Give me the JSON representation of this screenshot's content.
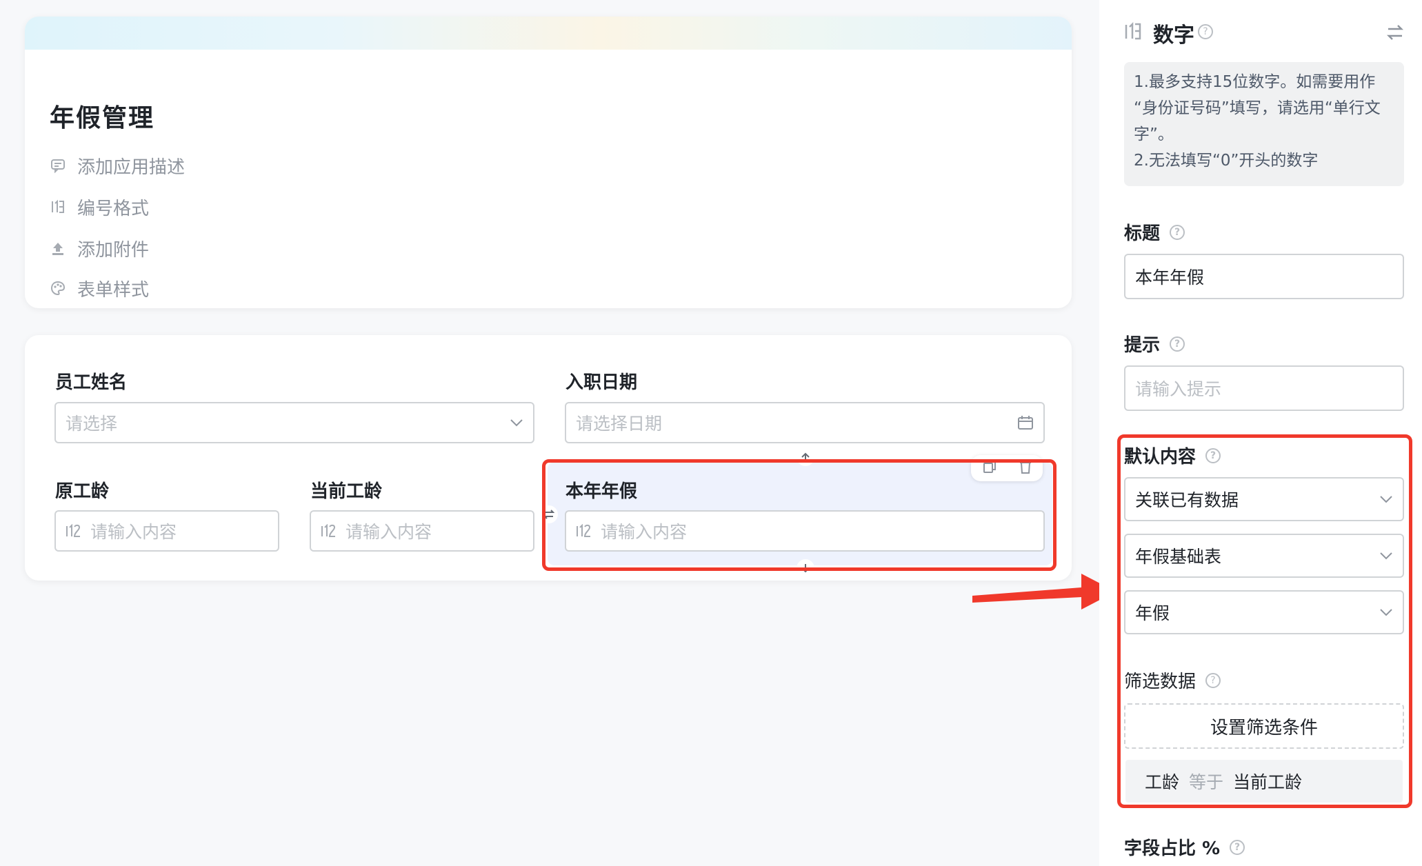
{
  "app": {
    "title": "年假管理",
    "header_items": [
      {
        "label": "添加应用描述",
        "icon": "comment-icon"
      },
      {
        "label": "编号格式",
        "icon": "number-format-icon"
      },
      {
        "label": "添加附件",
        "icon": "upload-icon"
      },
      {
        "label": "表单样式",
        "icon": "palette-icon"
      }
    ]
  },
  "form": {
    "fields": {
      "employee_name": {
        "label": "员工姓名",
        "placeholder": "请选择"
      },
      "hire_date": {
        "label": "入职日期",
        "placeholder": "请选择日期"
      },
      "original_seniority": {
        "label": "原工龄",
        "placeholder": "请输入内容"
      },
      "current_seniority": {
        "label": "当前工龄",
        "placeholder": "请输入内容"
      },
      "annual_leave": {
        "label": "本年年假",
        "placeholder": "请输入内容"
      }
    }
  },
  "panel": {
    "type_title": "数字",
    "info_lines": [
      "1.最多支持15位数字。如需要用作",
      "“身份证号码”填写，请选用“单行文",
      "字”。",
      "2.无法填写“0”开头的数字"
    ],
    "title_label": "标题",
    "title_value": "本年年假",
    "hint_label": "提示",
    "hint_placeholder": "请输入提示",
    "default_label": "默认内容",
    "default_mode": "关联已有数据",
    "source_form": "年假基础表",
    "source_field": "年假",
    "filter_label": "筛选数据",
    "filter_button": "设置筛选条件",
    "condition": {
      "field": "工龄",
      "operator": "等于",
      "value": "当前工龄"
    },
    "width_label": "字段占比 %"
  },
  "colors": {
    "highlight": "#f0392b",
    "selected_bg": "#eef2fd",
    "accent_band": "#dff4fb"
  }
}
